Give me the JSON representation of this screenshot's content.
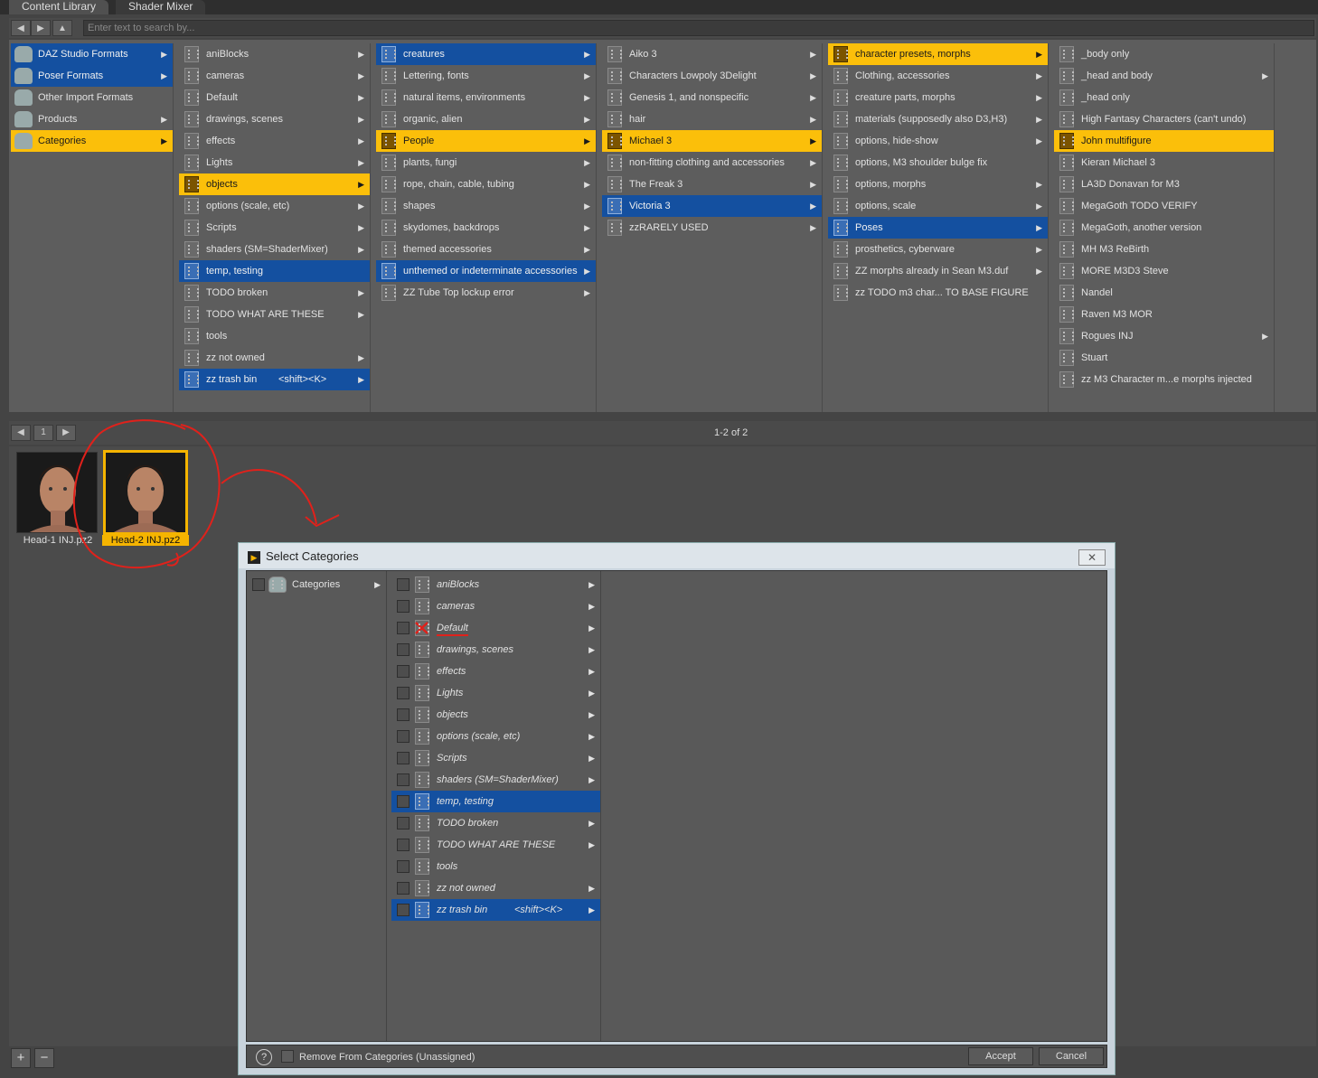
{
  "tabs": [
    "Content Library",
    "Shader Mixer"
  ],
  "search": {
    "placeholder": "Enter text to search by..."
  },
  "columns": [
    [
      {
        "label": "DAZ Studio Formats",
        "state": "blue",
        "arrow": true,
        "icon": "database-icon"
      },
      {
        "label": "Poser Formats",
        "state": "blue",
        "arrow": true,
        "icon": "database-icon"
      },
      {
        "label": "Other Import Formats",
        "state": "",
        "arrow": false,
        "icon": "database-icon"
      },
      {
        "label": "Products",
        "state": "",
        "arrow": true,
        "icon": "database-icon"
      },
      {
        "label": "Categories",
        "state": "yellow",
        "arrow": true,
        "icon": "database-icon"
      }
    ],
    [
      {
        "label": "aniBlocks",
        "state": "",
        "arrow": true
      },
      {
        "label": "cameras",
        "state": "",
        "arrow": true
      },
      {
        "label": "Default",
        "state": "",
        "arrow": true
      },
      {
        "label": "drawings, scenes",
        "state": "",
        "arrow": true
      },
      {
        "label": "effects",
        "state": "",
        "arrow": true
      },
      {
        "label": "Lights",
        "state": "",
        "arrow": true
      },
      {
        "label": "objects",
        "state": "yellow",
        "arrow": true
      },
      {
        "label": "options (scale, etc)",
        "state": "",
        "arrow": true
      },
      {
        "label": "Scripts",
        "state": "",
        "arrow": true
      },
      {
        "label": "shaders (SM=ShaderMixer)",
        "state": "",
        "arrow": true
      },
      {
        "label": "temp, testing",
        "state": "blue",
        "arrow": false
      },
      {
        "label": "TODO broken",
        "state": "",
        "arrow": true
      },
      {
        "label": "TODO WHAT ARE THESE",
        "state": "",
        "arrow": true
      },
      {
        "label": "tools",
        "state": "",
        "arrow": false
      },
      {
        "label": "zz not owned",
        "state": "",
        "arrow": true
      },
      {
        "label": "zz trash bin",
        "shortcut": "<shift><K>",
        "state": "blue",
        "arrow": true
      }
    ],
    [
      {
        "label": "creatures",
        "state": "blue",
        "arrow": true
      },
      {
        "label": "Lettering, fonts",
        "state": "",
        "arrow": true
      },
      {
        "label": "natural items, environments",
        "state": "",
        "arrow": true
      },
      {
        "label": "organic, alien",
        "state": "",
        "arrow": true
      },
      {
        "label": "People",
        "state": "yellow",
        "arrow": true
      },
      {
        "label": "plants, fungi",
        "state": "",
        "arrow": true
      },
      {
        "label": "rope, chain, cable, tubing",
        "state": "",
        "arrow": true
      },
      {
        "label": "shapes",
        "state": "",
        "arrow": true
      },
      {
        "label": "skydomes, backdrops",
        "state": "",
        "arrow": true
      },
      {
        "label": "themed accessories",
        "state": "",
        "arrow": true
      },
      {
        "label": "unthemed or indeterminate accessories",
        "state": "blue",
        "arrow": true
      },
      {
        "label": "ZZ Tube Top lockup error",
        "state": "",
        "arrow": true
      }
    ],
    [
      {
        "label": "Aiko 3",
        "state": "",
        "arrow": true
      },
      {
        "label": "Characters Lowpoly 3Delight",
        "state": "",
        "arrow": true
      },
      {
        "label": "Genesis 1, and nonspecific",
        "state": "",
        "arrow": true
      },
      {
        "label": "hair",
        "state": "",
        "arrow": true
      },
      {
        "label": "Michael 3",
        "state": "yellow",
        "arrow": true
      },
      {
        "label": "non-fitting clothing and accessories",
        "state": "",
        "arrow": true
      },
      {
        "label": "The Freak 3",
        "state": "",
        "arrow": true
      },
      {
        "label": "Victoria 3",
        "state": "blue",
        "arrow": true
      },
      {
        "label": "zzRARELY USED",
        "state": "",
        "arrow": true
      }
    ],
    [
      {
        "label": "character presets, morphs",
        "state": "yellow",
        "arrow": true
      },
      {
        "label": "Clothing, accessories",
        "state": "",
        "arrow": true
      },
      {
        "label": "creature parts, morphs",
        "state": "",
        "arrow": true
      },
      {
        "label": "materials (supposedly also D3,H3)",
        "state": "",
        "arrow": true
      },
      {
        "label": "options, hide-show",
        "state": "",
        "arrow": true
      },
      {
        "label": "options, M3 shoulder bulge fix",
        "state": "",
        "arrow": false
      },
      {
        "label": "options, morphs",
        "state": "",
        "arrow": true
      },
      {
        "label": "options, scale",
        "state": "",
        "arrow": true
      },
      {
        "label": "Poses",
        "state": "blue",
        "arrow": true
      },
      {
        "label": "prosthetics, cyberware",
        "state": "",
        "arrow": true
      },
      {
        "label": "ZZ morphs already in Sean M3.duf",
        "state": "",
        "arrow": true
      },
      {
        "label": "zz TODO m3 char... TO BASE FIGURE",
        "state": "",
        "arrow": false
      }
    ],
    [
      {
        "label": "_body only",
        "state": "",
        "arrow": false
      },
      {
        "label": "_head and body",
        "state": "",
        "arrow": true
      },
      {
        "label": "_head only",
        "state": "",
        "arrow": false
      },
      {
        "label": "High Fantasy Characters (can't undo)",
        "state": "",
        "arrow": false
      },
      {
        "label": "John multifigure",
        "state": "yellow",
        "arrow": false
      },
      {
        "label": "Kieran Michael 3",
        "state": "",
        "arrow": false
      },
      {
        "label": "LA3D Donavan for M3",
        "state": "",
        "arrow": false
      },
      {
        "label": "MegaGoth TODO VERIFY",
        "state": "",
        "arrow": false
      },
      {
        "label": "MegaGoth, another version",
        "state": "",
        "arrow": false
      },
      {
        "label": "MH M3 ReBirth",
        "state": "",
        "arrow": false
      },
      {
        "label": "MORE M3D3 Steve",
        "state": "",
        "arrow": false
      },
      {
        "label": "Nandel",
        "state": "",
        "arrow": false
      },
      {
        "label": "Raven M3 MOR",
        "state": "",
        "arrow": false
      },
      {
        "label": "Rogues INJ",
        "state": "",
        "arrow": true
      },
      {
        "label": "Stuart",
        "state": "",
        "arrow": false
      },
      {
        "label": "zz M3 Character m...e morphs injected",
        "state": "",
        "arrow": false
      }
    ]
  ],
  "pager": {
    "page": "1",
    "count": "1-2 of 2"
  },
  "results": [
    {
      "label": "Head-1 INJ.pz2",
      "selected": false
    },
    {
      "label": "Head-2 INJ.pz2",
      "selected": true
    }
  ],
  "dialog": {
    "title": "Select Categories",
    "close": "✕",
    "root": {
      "label": "Categories"
    },
    "items": [
      {
        "label": "aniBlocks",
        "state": "",
        "arrow": true
      },
      {
        "label": "cameras",
        "state": "",
        "arrow": true
      },
      {
        "label": "Default",
        "state": "",
        "arrow": true,
        "marked": true
      },
      {
        "label": "drawings, scenes",
        "state": "",
        "arrow": true
      },
      {
        "label": "effects",
        "state": "",
        "arrow": true
      },
      {
        "label": "Lights",
        "state": "",
        "arrow": true
      },
      {
        "label": "objects",
        "state": "",
        "arrow": true
      },
      {
        "label": "options (scale, etc)",
        "state": "",
        "arrow": true
      },
      {
        "label": "Scripts",
        "state": "",
        "arrow": true
      },
      {
        "label": "shaders (SM=ShaderMixer)",
        "state": "",
        "arrow": true
      },
      {
        "label": "temp, testing",
        "state": "blue",
        "arrow": false
      },
      {
        "label": "TODO broken",
        "state": "",
        "arrow": true
      },
      {
        "label": "TODO WHAT ARE THESE",
        "state": "",
        "arrow": true
      },
      {
        "label": "tools",
        "state": "",
        "arrow": false
      },
      {
        "label": "zz not owned",
        "state": "",
        "arrow": true
      },
      {
        "label": "zz trash bin",
        "shortcut": "<shift><K>",
        "state": "blue",
        "arrow": true
      }
    ],
    "footer": {
      "help": "?",
      "remove_label": "Remove From Categories (Unassigned)",
      "accept": "Accept",
      "cancel": "Cancel"
    }
  },
  "bottom_buttons": {
    "add": "+",
    "remove": "−"
  },
  "annotation_color": "#e0211b"
}
